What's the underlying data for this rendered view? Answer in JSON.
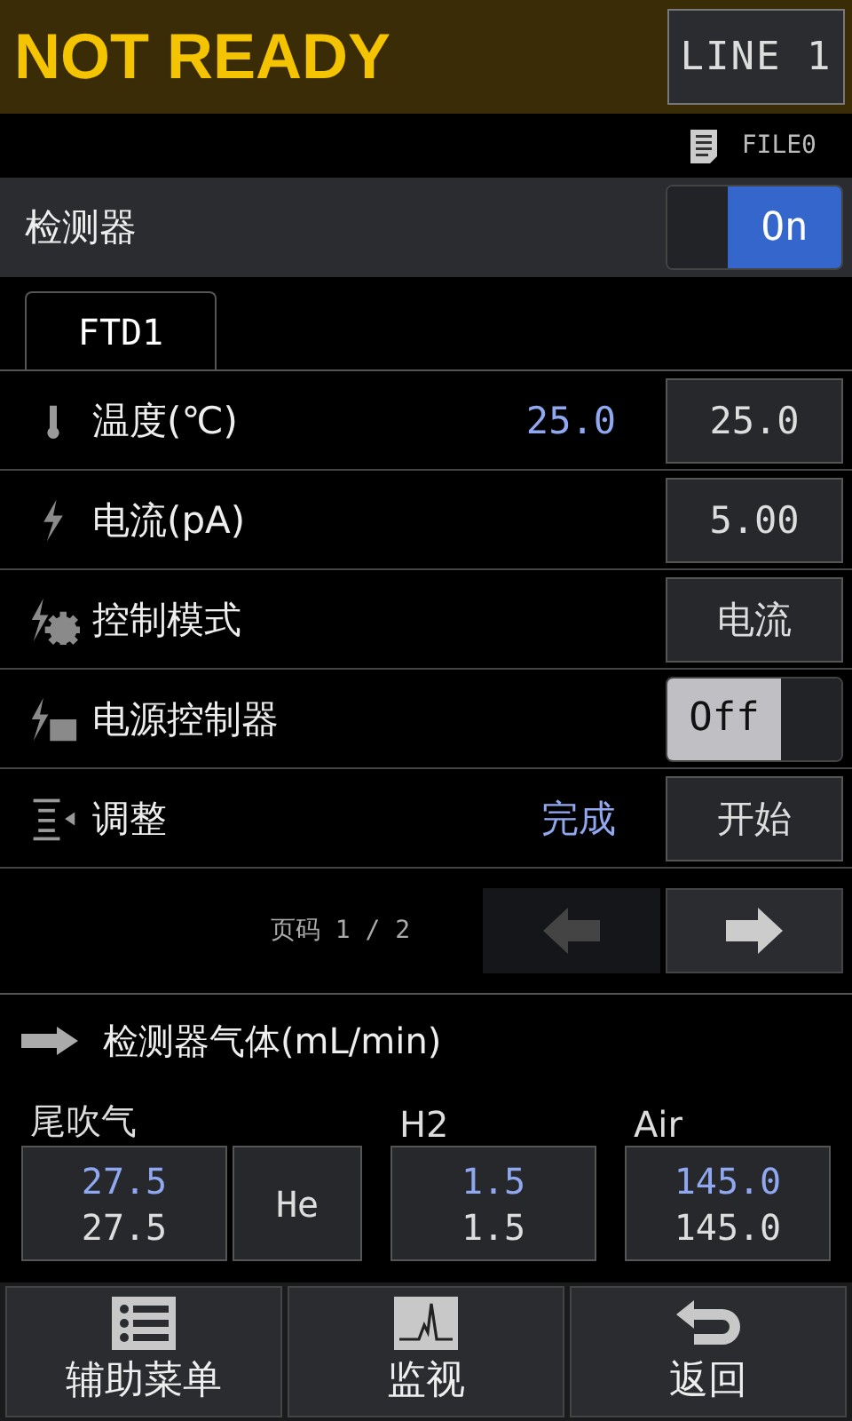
{
  "header": {
    "status": "NOT READY",
    "line_button": "LINE 1"
  },
  "file": {
    "name": "FILE0"
  },
  "detector": {
    "label": "检测器",
    "on": true,
    "toggle_text": "On"
  },
  "tabs": [
    {
      "label": "FTD1",
      "selected": true
    }
  ],
  "rows": [
    {
      "kind": "value_button",
      "label": "温度(℃)",
      "reading": "25.0",
      "button": "25.0"
    },
    {
      "kind": "value_button",
      "label": "电流(pA)",
      "button": "5.00"
    },
    {
      "kind": "value_button",
      "label": "控制模式",
      "button": "电流"
    },
    {
      "kind": "toggle",
      "label": "电源控制器",
      "on": false,
      "toggle_text": "Off"
    },
    {
      "kind": "value_button",
      "label": "调整",
      "reading": "完成",
      "button": "开始"
    }
  ],
  "pager": {
    "text": "页码 1 / 2",
    "prev_disabled": true,
    "next_disabled": false
  },
  "gas_section": {
    "title": "检测器气体(mL/min)",
    "groups": [
      {
        "label": "尾吹气",
        "setpoint": "27.5",
        "actual": "27.5",
        "gas_type": "He"
      },
      {
        "label": "H2",
        "setpoint": "1.5",
        "actual": "1.5"
      },
      {
        "label": "Air",
        "setpoint": "145.0",
        "actual": "145.0"
      }
    ]
  },
  "footer": [
    {
      "kind": "menu",
      "label": "辅助菜单"
    },
    {
      "kind": "monitor",
      "label": "监视"
    },
    {
      "kind": "back",
      "label": "返回"
    }
  ]
}
